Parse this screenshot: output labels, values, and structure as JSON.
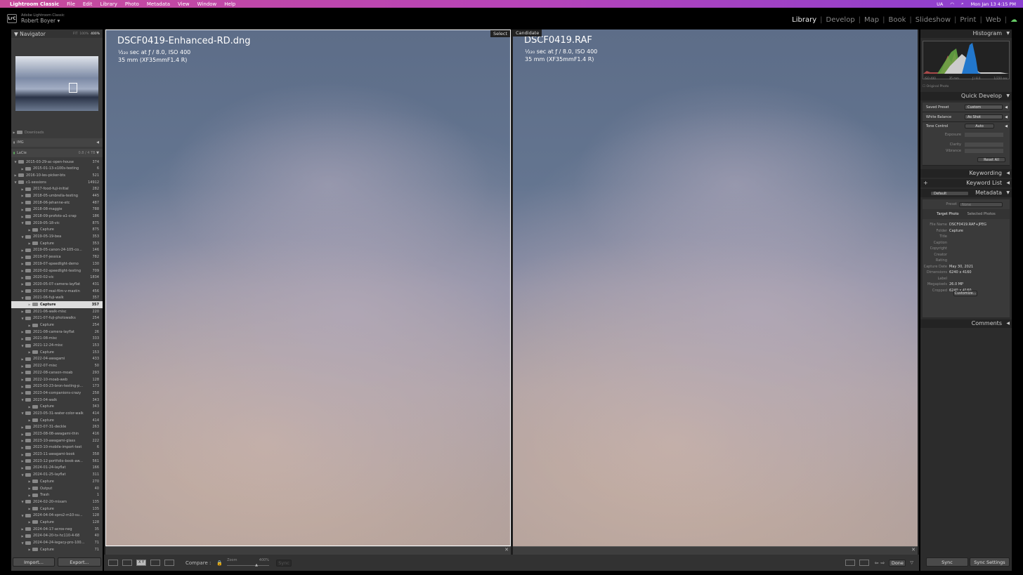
{
  "menubar": {
    "app": "Lightroom Classic",
    "items": [
      "File",
      "Edit",
      "Library",
      "Photo",
      "Metadata",
      "View",
      "Window",
      "Help"
    ],
    "status": {
      "input": "UA",
      "datetime": "Mon Jan 13  4:15 PM"
    }
  },
  "header": {
    "logo": "LrC",
    "brand": "Adobe Lightroom Classic",
    "user": "Robert Boyer ▾",
    "modules": [
      "Library",
      "Develop",
      "Map",
      "Book",
      "Slideshow",
      "Print",
      "Web"
    ],
    "active_module": "Library"
  },
  "navigator": {
    "title": "Navigator",
    "fit": "FIT",
    "zoom100": "100%",
    "zoom400": "400%"
  },
  "volumes": [
    {
      "name": "Downloads",
      "count": ""
    },
    {
      "name": "IMG",
      "count": ""
    },
    {
      "name": "LaCie",
      "count": "0.8 / 4 TB"
    }
  ],
  "folders": [
    {
      "n": "2015-03-29-ac-open-house",
      "c": "374",
      "l": 1,
      "e": true
    },
    {
      "n": "2015-01-13-x100s-testing",
      "c": "6",
      "l": 2
    },
    {
      "n": "2016-10-les-picker-bts",
      "c": "521",
      "l": 1
    },
    {
      "n": "c1-sessions",
      "c": "14912",
      "l": 1,
      "e": true
    },
    {
      "n": "2017-food-fuji-initial",
      "c": "282",
      "l": 2
    },
    {
      "n": "2018-05-umbrella-testing",
      "c": "445",
      "l": 2
    },
    {
      "n": "2018-06-jehanne-etc",
      "c": "487",
      "l": 2
    },
    {
      "n": "2018-08-maggie",
      "c": "788",
      "l": 2
    },
    {
      "n": "2018-09-profoto-a1-crap",
      "c": "186",
      "l": 2
    },
    {
      "n": "2019-05-18-vic",
      "c": "875",
      "l": 2,
      "e": true
    },
    {
      "n": "Capture",
      "c": "875",
      "l": 3
    },
    {
      "n": "2019-05-19-bea",
      "c": "353",
      "l": 2,
      "e": true
    },
    {
      "n": "Capture",
      "c": "353",
      "l": 3
    },
    {
      "n": "2019-05-canon-24-105-co...",
      "c": "146",
      "l": 2
    },
    {
      "n": "2019-07-jessica",
      "c": "782",
      "l": 2
    },
    {
      "n": "2019-07-speedlight-demo",
      "c": "130",
      "l": 2
    },
    {
      "n": "2020-02-speedlight-testing",
      "c": "709",
      "l": 2
    },
    {
      "n": "2020-02-vic",
      "c": "1834",
      "l": 2
    },
    {
      "n": "2020-05-07-camera-layflat",
      "c": "431",
      "l": 2
    },
    {
      "n": "2020-07-real-film-v-mastin",
      "c": "456",
      "l": 2
    },
    {
      "n": "2021-06-fuji-walk",
      "c": "357",
      "l": 2,
      "e": true
    },
    {
      "n": "Capture",
      "c": "357",
      "l": 3,
      "s": true
    },
    {
      "n": "2021-06-walk-misc",
      "c": "220",
      "l": 2
    },
    {
      "n": "2021-07-fuji-photowalks",
      "c": "254",
      "l": 2,
      "e": true
    },
    {
      "n": "Capture",
      "c": "254",
      "l": 3
    },
    {
      "n": "2021-08-camera-layflat",
      "c": "26",
      "l": 2
    },
    {
      "n": "2021-08-misc",
      "c": "333",
      "l": 2
    },
    {
      "n": "2021-12-24-misc",
      "c": "153",
      "l": 2,
      "e": true
    },
    {
      "n": "Capture",
      "c": "153",
      "l": 3
    },
    {
      "n": "2022-04-awagami",
      "c": "433",
      "l": 2
    },
    {
      "n": "2022-07-misc",
      "c": "50",
      "l": 2
    },
    {
      "n": "2022-08-canson-moab",
      "c": "293",
      "l": 2
    },
    {
      "n": "2022-10-moab-web",
      "c": "128",
      "l": 2
    },
    {
      "n": "2023-03-23-bron-testing-p...",
      "c": "173",
      "l": 2
    },
    {
      "n": "2023-04-companions-crazy",
      "c": "258",
      "l": 2
    },
    {
      "n": "2023-04-walk",
      "c": "343",
      "l": 2,
      "e": true
    },
    {
      "n": "Capture",
      "c": "343",
      "l": 3
    },
    {
      "n": "2023-05-31-water-color-walk",
      "c": "414",
      "l": 2,
      "e": true
    },
    {
      "n": "Capture",
      "c": "414",
      "l": 3
    },
    {
      "n": "2023-07-31-deckle",
      "c": "263",
      "l": 2
    },
    {
      "n": "2023-08-08-awagami-thin",
      "c": "416",
      "l": 2
    },
    {
      "n": "2023-10-awagami-glass",
      "c": "222",
      "l": 2
    },
    {
      "n": "2023-10-mobile-import-test",
      "c": "6",
      "l": 2
    },
    {
      "n": "2023-11-awagami-book",
      "c": "358",
      "l": 2
    },
    {
      "n": "2023-12-portfolio-book-aw...",
      "c": "561",
      "l": 2
    },
    {
      "n": "2024-01-24-layflat",
      "c": "166",
      "l": 2
    },
    {
      "n": "2024-01-25-layflat",
      "c": "311",
      "l": 2,
      "e": true
    },
    {
      "n": "Capture",
      "c": "270",
      "l": 3
    },
    {
      "n": "Output",
      "c": "40",
      "l": 3
    },
    {
      "n": "Trash",
      "c": "1",
      "l": 3
    },
    {
      "n": "2024-02-20-mixam",
      "c": "135",
      "l": 2,
      "e": true
    },
    {
      "n": "Capture",
      "c": "135",
      "l": 3
    },
    {
      "n": "2024-04-04-xpro2-m10-su...",
      "c": "128",
      "l": 2,
      "e": true
    },
    {
      "n": "Capture",
      "c": "128",
      "l": 3
    },
    {
      "n": "2024-04-17-acros-neg",
      "c": "35",
      "l": 2
    },
    {
      "n": "2024-04-20-tx-hc110-4-68",
      "c": "40",
      "l": 2
    },
    {
      "n": "2024-04-24-legacy-pro-100...",
      "c": "71",
      "l": 2,
      "e": true
    },
    {
      "n": "Capture",
      "c": "71",
      "l": 3
    }
  ],
  "left_buttons": {
    "import": "Import...",
    "export": "Export..."
  },
  "select": {
    "tag": "Select",
    "filename": "DSCF0419-Enhanced-RD.dng",
    "exposure": "¹⁄₂₂₀ sec at ƒ / 8.0, ISO 400",
    "lens": "35 mm (XF35mmF1.4 R)"
  },
  "candidate": {
    "tag": "Candidate",
    "filename": "DSCF0419.RAF",
    "exposure": "¹⁄₂₂₀ sec at ƒ / 8.0, ISO 400",
    "lens": "35 mm (XF35mmF1.4 R)"
  },
  "toolbar": {
    "compare": "Compare :",
    "zoom_label": "Zoom",
    "zoom_value": "400%",
    "sync": "Sync",
    "xy": "X Y",
    "done": "Done"
  },
  "histogram": {
    "title": "Histogram",
    "iso": "ISO 400",
    "focal": "35 mm",
    "aperture": "ƒ / 8.0",
    "shutter": "1/220 sec",
    "original": "Original Photo"
  },
  "quick_develop": {
    "title": "Quick Develop",
    "saved_preset_label": "Saved Preset",
    "saved_preset": "Custom",
    "wb_label": "White Balance",
    "wb": "As Shot",
    "tone_label": "Tone Control",
    "auto": "Auto",
    "exposure": "Exposure",
    "clarity": "Clarity",
    "vibrance": "Vibrance",
    "reset": "Reset All"
  },
  "panels": {
    "keywording": "Keywording",
    "keyword_list": "Keyword List",
    "metadata": "Metadata",
    "comments": "Comments",
    "metadata_set": "Default"
  },
  "metadata": {
    "preset_label": "Preset",
    "preset": "None",
    "tab_target": "Target Photo",
    "tab_selected": "Selected Photos",
    "fields": [
      [
        "File Name",
        "DSCF0419.RAF+JPEG"
      ],
      [
        "Folder",
        "Capture"
      ],
      [
        "Title",
        ""
      ],
      [
        "Caption",
        ""
      ],
      [
        "Copyright",
        ""
      ],
      [
        "Creator",
        ""
      ],
      [
        "Rating",
        ""
      ],
      [
        "Capture Date",
        "May 30, 2021"
      ],
      [
        "Dimensions",
        "6240 x 4160"
      ],
      [
        "Label",
        ""
      ],
      [
        "Megapixels",
        "26.0 MP"
      ],
      [
        "Cropped",
        "6240 x 4160"
      ]
    ],
    "customize": "Customize..."
  },
  "right_buttons": {
    "sync": "Sync",
    "sync_settings": "Sync Settings"
  }
}
